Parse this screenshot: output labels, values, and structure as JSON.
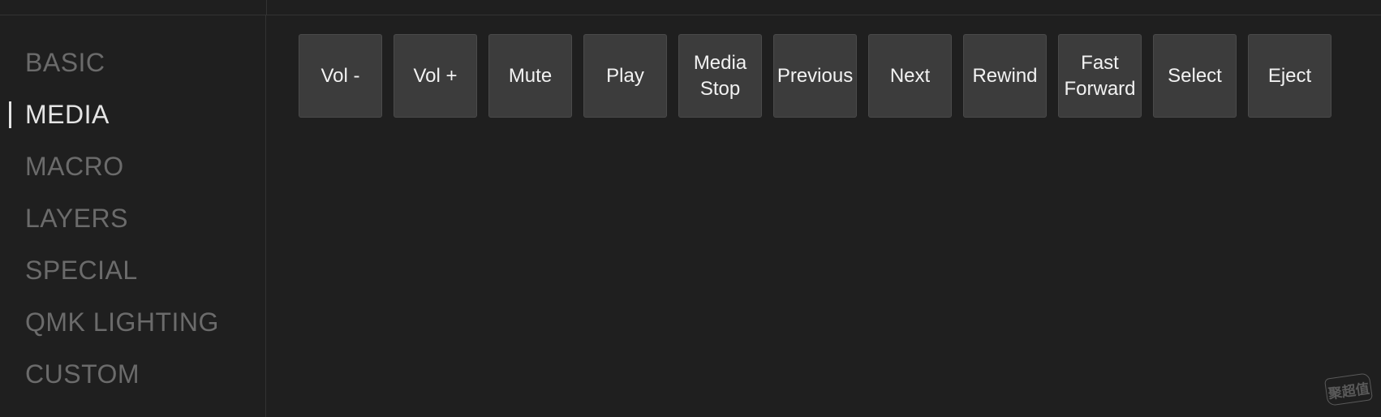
{
  "sidebar": {
    "items": [
      {
        "label": "BASIC",
        "active": false
      },
      {
        "label": "MEDIA",
        "active": true
      },
      {
        "label": "MACRO",
        "active": false
      },
      {
        "label": "LAYERS",
        "active": false
      },
      {
        "label": "SPECIAL",
        "active": false
      },
      {
        "label": "QMK LIGHTING",
        "active": false
      },
      {
        "label": "CUSTOM",
        "active": false
      }
    ]
  },
  "keys": [
    {
      "label": "Vol -"
    },
    {
      "label": "Vol +"
    },
    {
      "label": "Mute"
    },
    {
      "label": "Play"
    },
    {
      "label": "Media\nStop"
    },
    {
      "label": "Previous"
    },
    {
      "label": "Next"
    },
    {
      "label": "Rewind"
    },
    {
      "label": "Fast\nForward"
    },
    {
      "label": "Select"
    },
    {
      "label": "Eject"
    }
  ],
  "watermark": {
    "text": "聚超值"
  },
  "colors": {
    "background": "#1f1f1f",
    "key_background": "#3c3c3c",
    "active_text": "#e4e4e4",
    "inactive_text": "#6b6b6b"
  }
}
